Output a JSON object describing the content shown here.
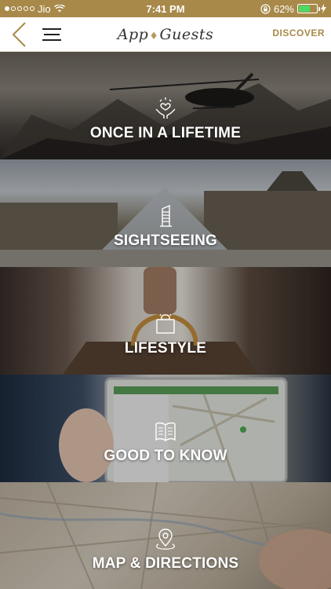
{
  "status_bar": {
    "carrier": "Jio",
    "time": "7:41 PM",
    "battery_percent": "62%",
    "battery_level": 0.62,
    "signal_dots_filled": 1,
    "signal_dots_total": 5
  },
  "nav": {
    "logo_left": "App",
    "logo_right": "Guests",
    "discover_label": "DISCOVER"
  },
  "tiles": [
    {
      "label": "ONCE IN A LIFETIME",
      "icon": "hands-heart-icon"
    },
    {
      "label": "SIGHTSEEING",
      "icon": "building-icon"
    },
    {
      "label": "LIFESTYLE",
      "icon": "shopping-bag-icon"
    },
    {
      "label": "GOOD TO KNOW",
      "icon": "open-book-icon"
    },
    {
      "label": "MAP & DIRECTIONS",
      "icon": "map-pin-icon"
    }
  ],
  "colors": {
    "accent": "#a8894a",
    "battery_green": "#4cd964"
  }
}
